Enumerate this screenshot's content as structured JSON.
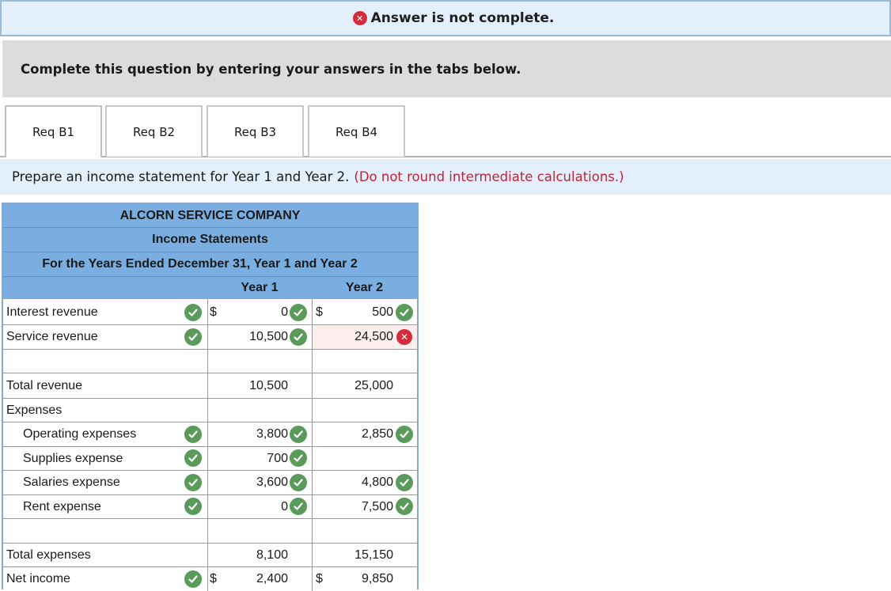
{
  "banner": {
    "status_text": "Answer is not complete."
  },
  "instruction": "Complete this question by entering your answers in the tabs below.",
  "tabs": [
    {
      "label": "Req B1",
      "active": true
    },
    {
      "label": "Req B2",
      "active": false
    },
    {
      "label": "Req B3",
      "active": false
    },
    {
      "label": "Req B4",
      "active": false
    }
  ],
  "prompt": {
    "text": "Prepare an income statement for Year 1 and Year 2.",
    "note": "(Do not round intermediate calculations.)"
  },
  "statement": {
    "company": "ALCORN SERVICE COMPANY",
    "title": "Income Statements",
    "period": "For the Years Ended December 31, Year 1 and Year 2",
    "col_year1": "Year 1",
    "col_year2": "Year 2",
    "currency": "$",
    "rows": {
      "interest_revenue": {
        "label": "Interest revenue",
        "y1": "0",
        "y2": "500"
      },
      "service_revenue": {
        "label": "Service revenue",
        "y1": "10,500",
        "y2": "24,500"
      },
      "total_revenue": {
        "label": "Total revenue",
        "y1": "10,500",
        "y2": "25,000"
      },
      "expenses": {
        "label": "Expenses"
      },
      "operating_expenses": {
        "label": "Operating expenses",
        "y1": "3,800",
        "y2": "2,850"
      },
      "supplies_expense": {
        "label": "Supplies expense",
        "y1": "700",
        "y2": ""
      },
      "salaries_expense": {
        "label": "Salaries expense",
        "y1": "3,600",
        "y2": "4,800"
      },
      "rent_expense": {
        "label": "Rent expense",
        "y1": "0",
        "y2": "7,500"
      },
      "total_expenses": {
        "label": "Total expenses",
        "y1": "8,100",
        "y2": "15,150"
      },
      "net_income": {
        "label": "Net income",
        "y1": "2,400",
        "y2": "9,850"
      }
    }
  },
  "colors": {
    "banner_bg": "#e3effa",
    "header_blue": "#7aaee0",
    "correct_green": "#5a9a5a",
    "incorrect_red": "#d62c3a",
    "note_red": "#c0253a"
  }
}
